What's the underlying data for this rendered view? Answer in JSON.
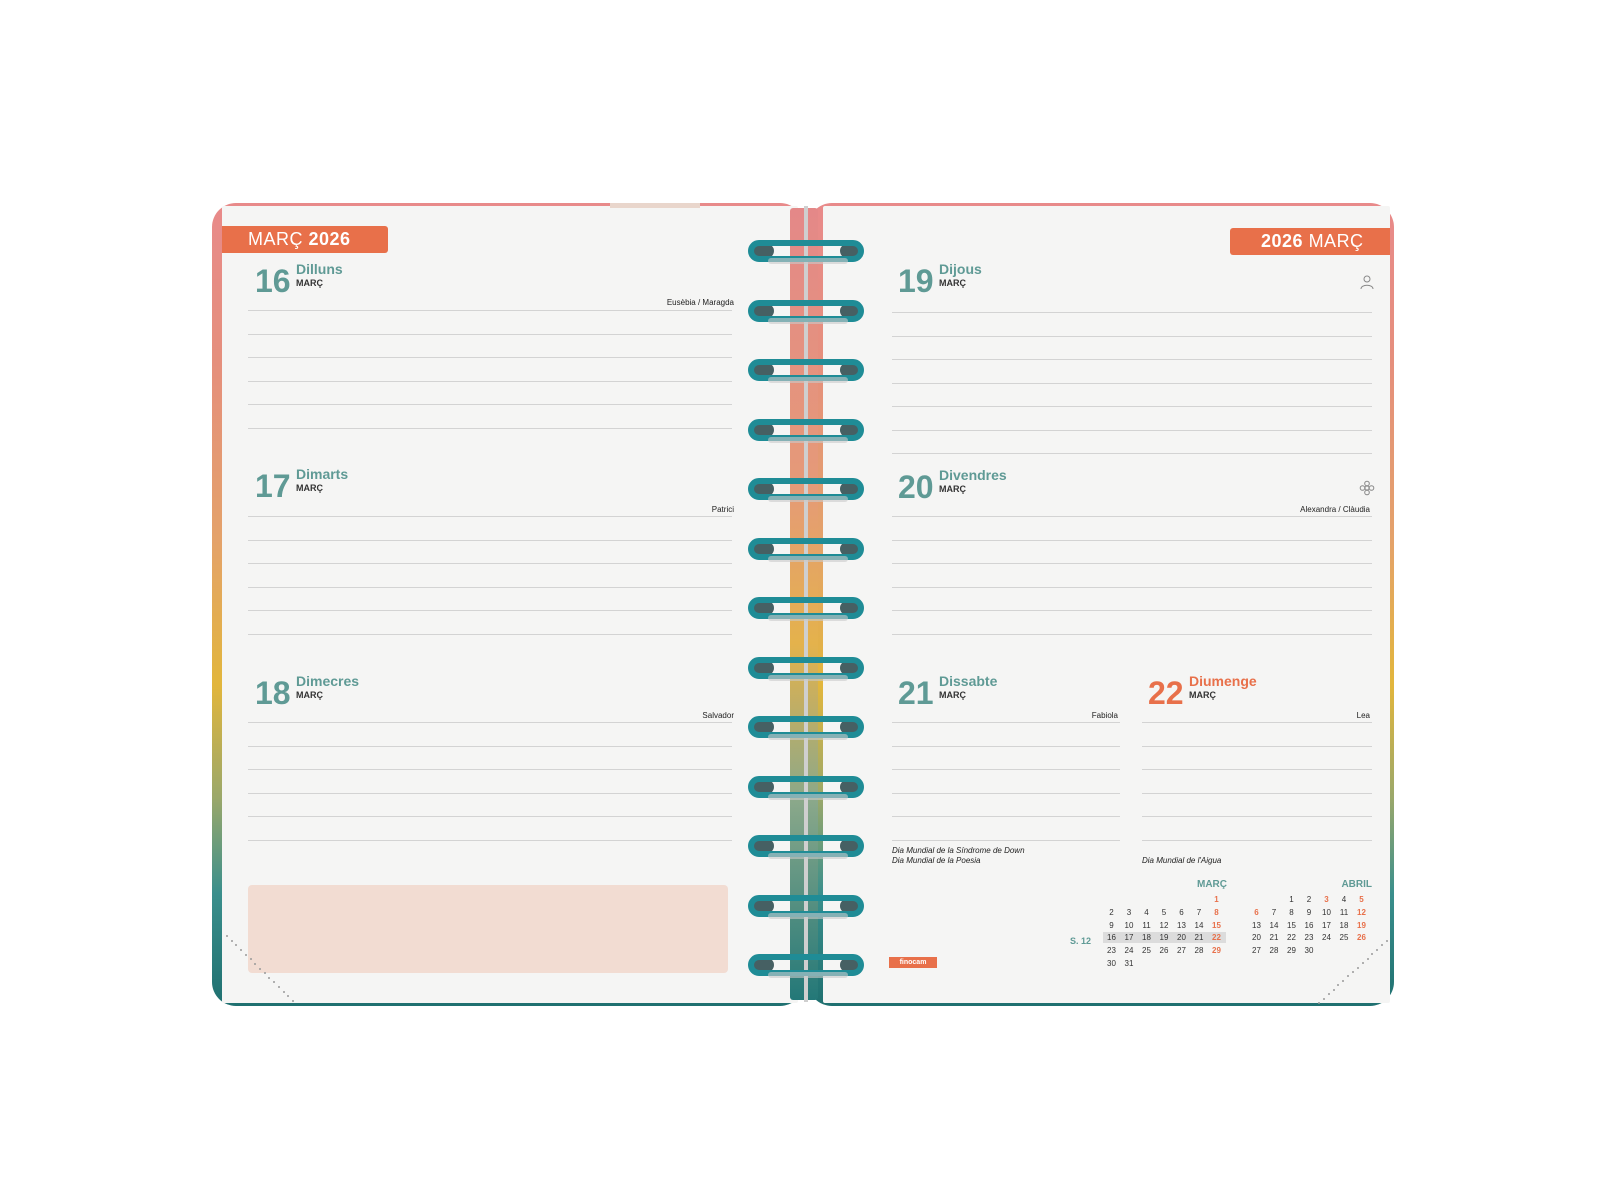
{
  "header": {
    "left": {
      "month": "MARÇ",
      "year": "2026"
    },
    "right": {
      "year": "2026",
      "month": "MARÇ"
    }
  },
  "days": [
    {
      "num": "16",
      "name": "Dilluns",
      "month": "MARÇ",
      "saint": "Eusèbia / Maragda"
    },
    {
      "num": "17",
      "name": "Dimarts",
      "month": "MARÇ",
      "saint": "Patrici"
    },
    {
      "num": "18",
      "name": "Dimecres",
      "month": "MARÇ",
      "saint": "Salvador"
    },
    {
      "num": "19",
      "name": "Dijous",
      "month": "MARÇ",
      "saint": ""
    },
    {
      "num": "20",
      "name": "Divendres",
      "month": "MARÇ",
      "saint": "Alexandra / Clàudia"
    },
    {
      "num": "21",
      "name": "Dissabte",
      "month": "MARÇ",
      "saint": "Fabiola"
    },
    {
      "num": "22",
      "name": "Diumenge",
      "month": "MARÇ",
      "saint": "Lea"
    }
  ],
  "events": {
    "d21": [
      "Dia Mundial de la Síndrome de Down",
      "Dia Mundial de la Poesia"
    ],
    "d22": [
      "Dia Mundial de l'Aigua"
    ]
  },
  "icons": {
    "d19": "person-outline-icon",
    "d20": "flower-icon"
  },
  "brand": "finocam",
  "week_label": "S. 12",
  "mini_calendars": [
    {
      "title": "MARÇ",
      "rows": [
        [
          "",
          "",
          "",
          "",
          "",
          "",
          "1"
        ],
        [
          "2",
          "3",
          "4",
          "5",
          "6",
          "7",
          "8"
        ],
        [
          "9",
          "10",
          "11",
          "12",
          "13",
          "14",
          "15"
        ],
        [
          "16",
          "17",
          "18",
          "19",
          "20",
          "21",
          "22"
        ],
        [
          "23",
          "24",
          "25",
          "26",
          "27",
          "28",
          "29"
        ],
        [
          "30",
          "31",
          "",
          "",
          "",
          "",
          ""
        ]
      ],
      "highlight_row": 3
    },
    {
      "title": "ABRIL",
      "rows": [
        [
          "",
          "",
          "1",
          "2",
          "3",
          "4",
          "5"
        ],
        [
          "6",
          "7",
          "8",
          "9",
          "10",
          "11",
          "12"
        ],
        [
          "13",
          "14",
          "15",
          "16",
          "17",
          "18",
          "19"
        ],
        [
          "20",
          "21",
          "22",
          "23",
          "24",
          "25",
          "26"
        ],
        [
          "27",
          "28",
          "29",
          "30",
          "",
          "",
          ""
        ]
      ]
    }
  ],
  "colors": {
    "accent": "#e8704a",
    "teal": "#5f9a95",
    "coil": "#1f8c96",
    "notes": "#f2dcd2"
  }
}
